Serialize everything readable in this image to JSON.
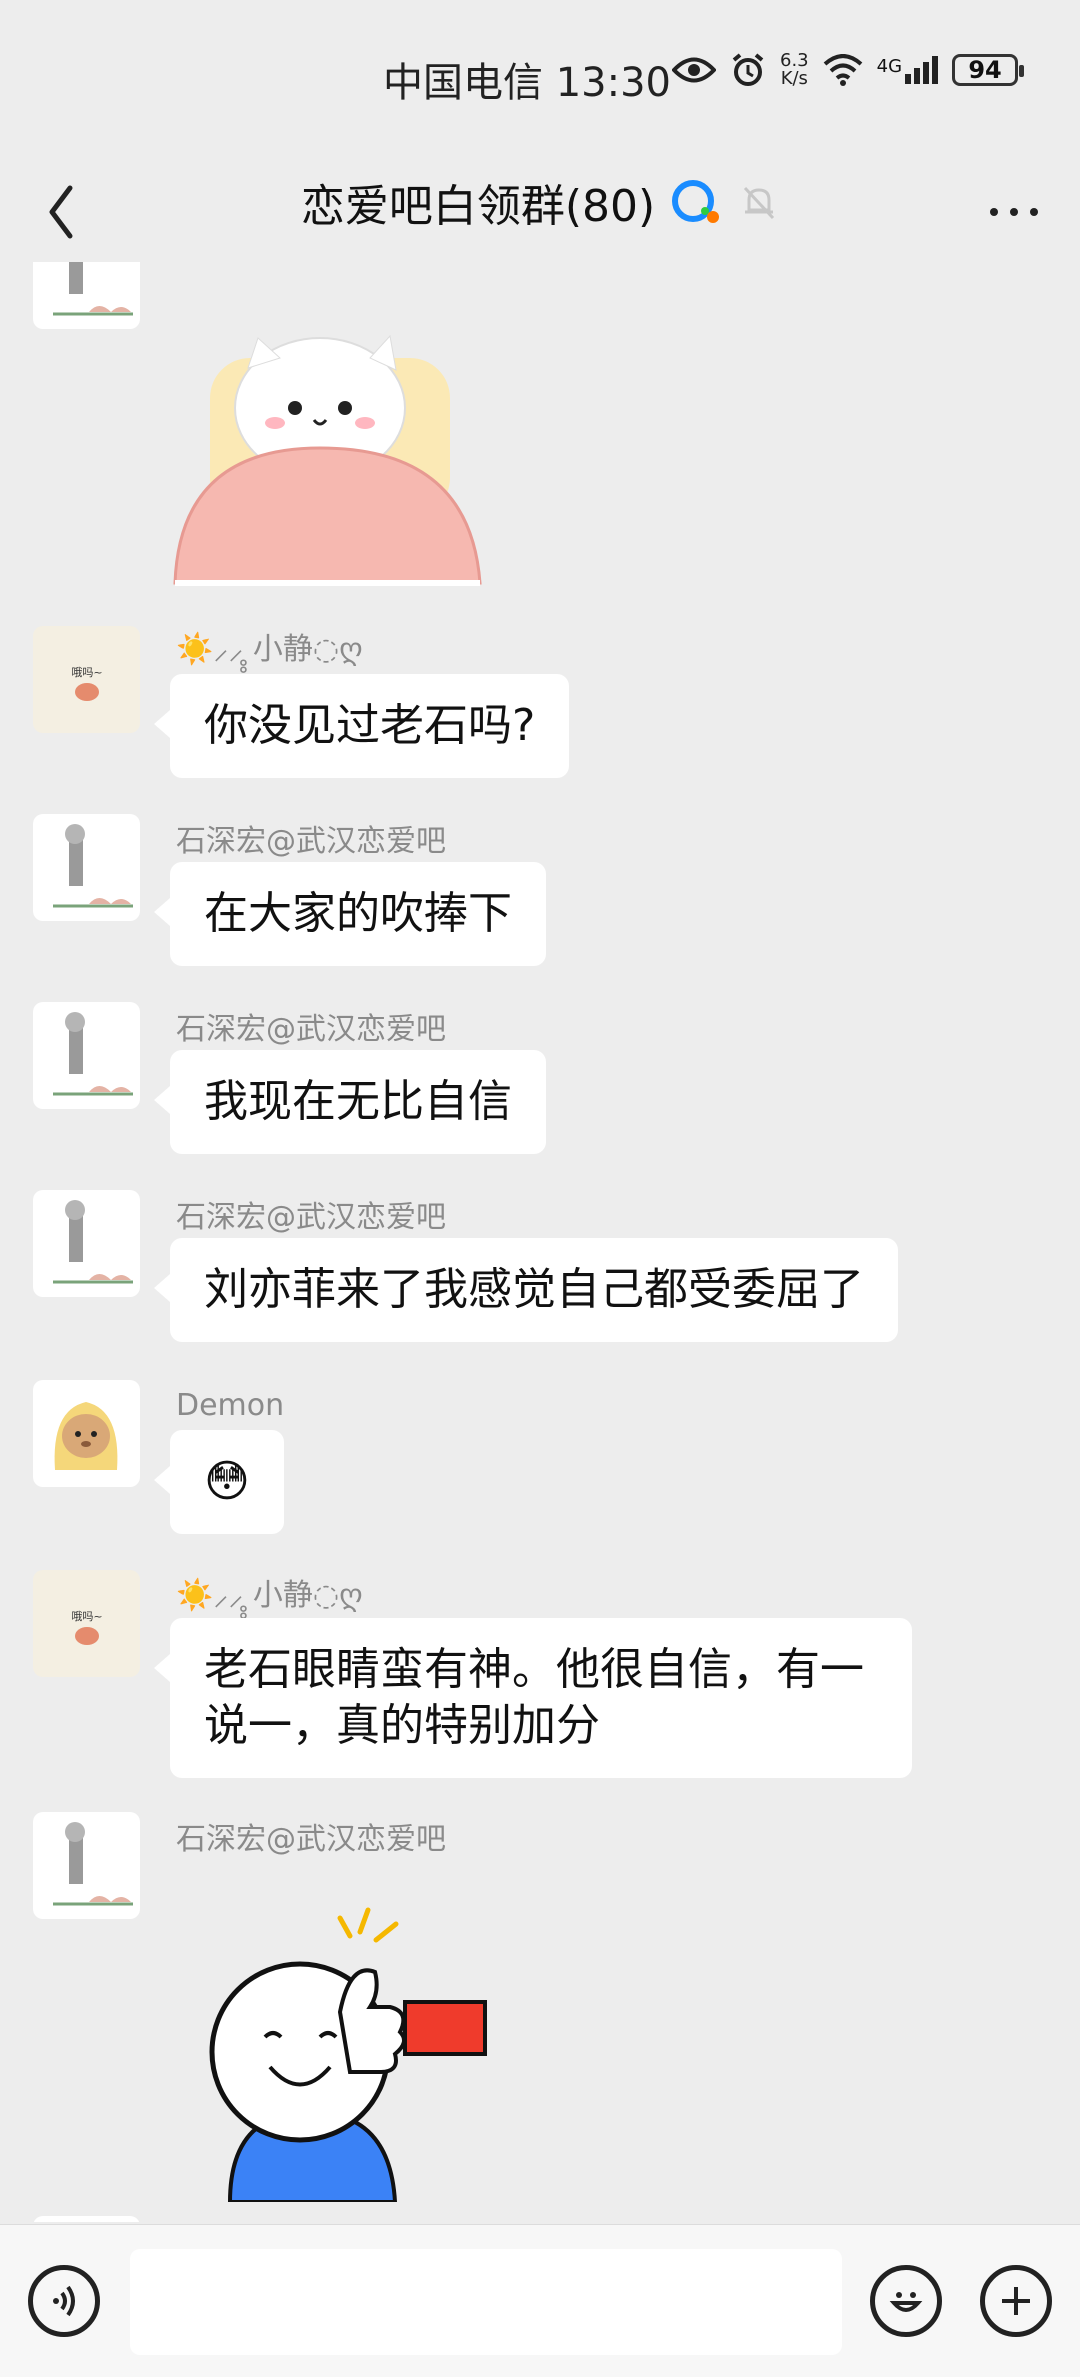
{
  "status": {
    "carrier_time": "中国电信 13:30",
    "speed_top": "6.3",
    "speed_bottom": "K/s",
    "network": "4G",
    "battery": "94"
  },
  "nav": {
    "title": "恋爱吧白领群(80)"
  },
  "messages": [
    {
      "sender": "☀️⸝⸝̥̥ 小静◌ღ",
      "text": "你没见过老石吗?"
    },
    {
      "sender": "石深宏@武汉恋爱吧",
      "text": "在大家的吹捧下"
    },
    {
      "sender": "石深宏@武汉恋爱吧",
      "text": "我现在无比自信"
    },
    {
      "sender": "石深宏@武汉恋爱吧",
      "text": "刘亦菲来了我感觉自己都受委屈了"
    },
    {
      "sender": "Demon",
      "text": "😳"
    },
    {
      "sender": "☀️⸝⸝̥̥ 小静◌ღ",
      "text": "老石眼睛蛮有神。他很自信，有一说一，真的特别加分"
    },
    {
      "sender": "石深宏@武汉恋爱吧",
      "text": ""
    }
  ],
  "avatar_text": "哦吗~",
  "input": {
    "placeholder": ""
  }
}
